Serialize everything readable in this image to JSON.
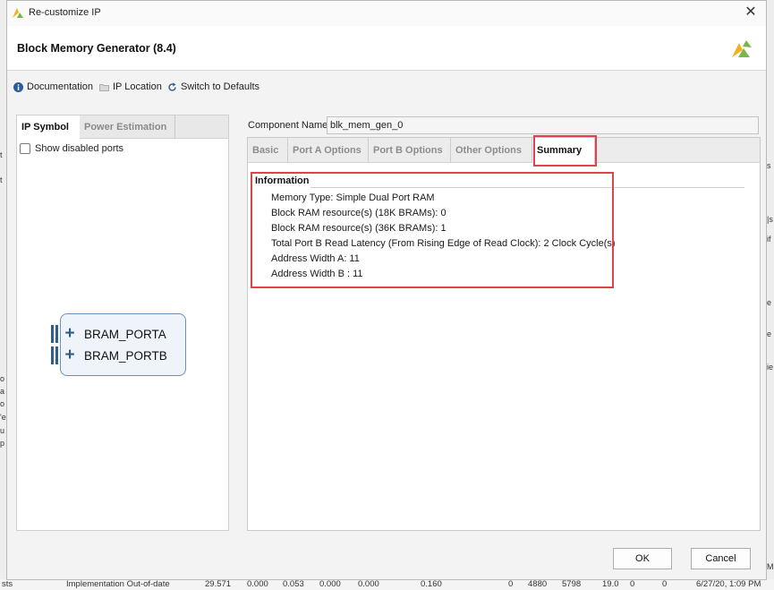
{
  "window": {
    "title": "Re-customize IP"
  },
  "header": {
    "title": "Block Memory Generator (8.4)"
  },
  "toolbar": {
    "documentation": "Documentation",
    "ip_location": "IP Location",
    "switch_defaults": "Switch to Defaults"
  },
  "left_panel": {
    "tabs": [
      "IP Symbol",
      "Power Estimation"
    ],
    "show_disabled_ports": "Show disabled ports",
    "ports": [
      "BRAM_PORTA",
      "BRAM_PORTB"
    ]
  },
  "component": {
    "label": "Component Name",
    "value": "blk_mem_gen_0"
  },
  "config_tabs": [
    "Basic",
    "Port A Options",
    "Port B Options",
    "Other Options",
    "Summary"
  ],
  "summary": {
    "section_title": "Information",
    "lines": [
      "Memory Type: Simple Dual Port RAM",
      "Block RAM resource(s) (18K BRAMs): 0",
      "Block RAM resource(s) (36K BRAMs): 1",
      "Total Port B Read Latency (From Rising Edge of Read Clock): 2 Clock Cycle(s)",
      "Address Width A: 11",
      "Address Width B : 11"
    ]
  },
  "buttons": {
    "ok": "OK",
    "cancel": "Cancel"
  },
  "background": {
    "bottom_text": [
      "sts",
      "Implementation Out-of-date",
      "29.571",
      "0.000",
      "0.053",
      "0.000",
      "0.000",
      "0.160",
      "0",
      "4880",
      "5798",
      "19.0",
      "0",
      "0",
      "6/27/20, 1:09 PM"
    ],
    "left_edge": [
      "t",
      "t",
      "o",
      "a",
      "o",
      "'e",
      "u",
      "p"
    ],
    "right_edge": [
      "s",
      "|s",
      "if",
      "e",
      "e",
      "ie",
      "M"
    ]
  },
  "colors": {
    "highlight": "#e0424b",
    "port_blue": "#2f5d8c"
  }
}
